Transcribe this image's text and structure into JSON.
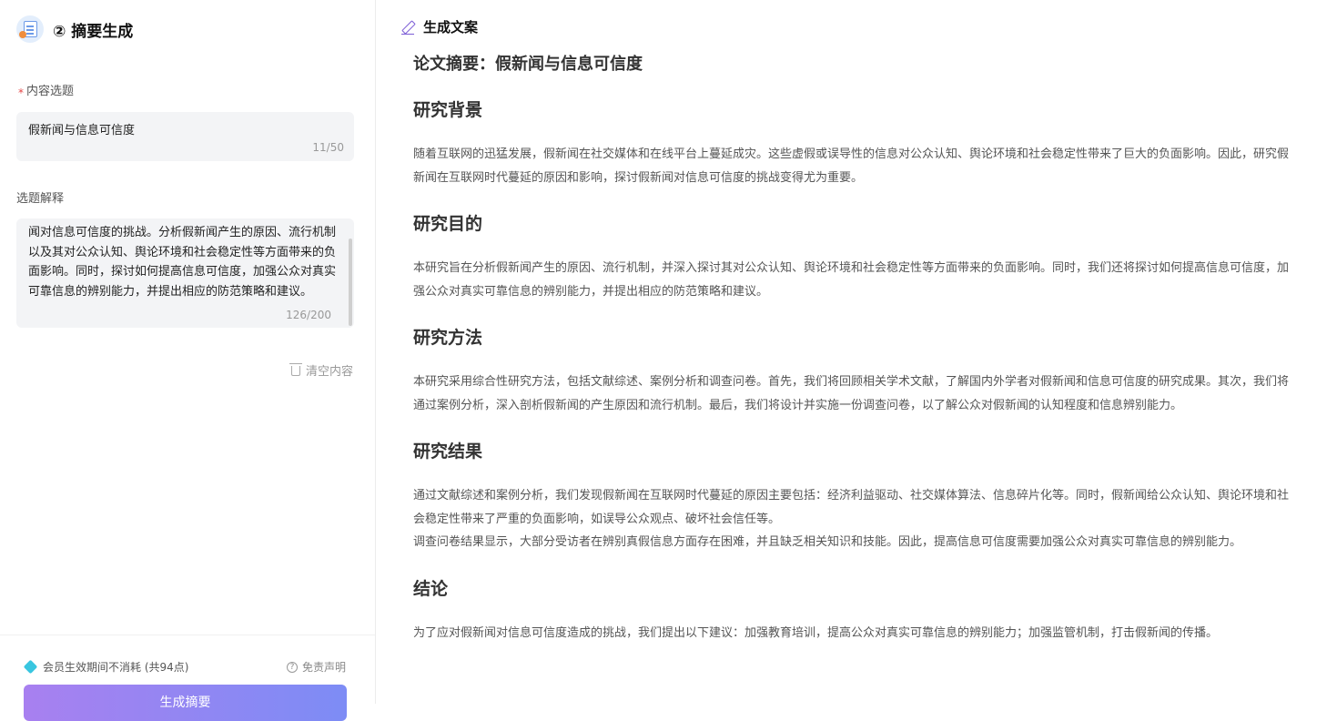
{
  "left": {
    "app_title": "② 摘要生成",
    "topic": {
      "required_mark": "*",
      "label": "内容选题",
      "value": "假新闻与信息可信度",
      "count": "11/50"
    },
    "explanation": {
      "label": "选题解释",
      "value": "闻对信息可信度的挑战。分析假新闻产生的原因、流行机制以及其对公众认知、舆论环境和社会稳定性等方面带来的负面影响。同时，探讨如何提高信息可信度，加强公众对真实可靠信息的辨别能力，并提出相应的防范策略和建议。",
      "count": "126/200"
    },
    "clear_label": "清空内容",
    "member_note": "会员生效期间不消耗 (共94点)",
    "disclaimer_label": "免责声明",
    "generate_label": "生成摘要"
  },
  "right": {
    "header_title": "生成文案",
    "doc_title": "论文摘要：假新闻与信息可信度",
    "sections": [
      {
        "heading": "研究背景",
        "paragraphs": [
          "随着互联网的迅猛发展，假新闻在社交媒体和在线平台上蔓延成灾。这些虚假或误导性的信息对公众认知、舆论环境和社会稳定性带来了巨大的负面影响。因此，研究假新闻在互联网时代蔓延的原因和影响，探讨假新闻对信息可信度的挑战变得尤为重要。"
        ]
      },
      {
        "heading": "研究目的",
        "paragraphs": [
          "本研究旨在分析假新闻产生的原因、流行机制，并深入探讨其对公众认知、舆论环境和社会稳定性等方面带来的负面影响。同时，我们还将探讨如何提高信息可信度，加强公众对真实可靠信息的辨别能力，并提出相应的防范策略和建议。"
        ]
      },
      {
        "heading": "研究方法",
        "paragraphs": [
          "本研究采用综合性研究方法，包括文献综述、案例分析和调查问卷。首先，我们将回顾相关学术文献，了解国内外学者对假新闻和信息可信度的研究成果。其次，我们将通过案例分析，深入剖析假新闻的产生原因和流行机制。最后，我们将设计并实施一份调查问卷，以了解公众对假新闻的认知程度和信息辨别能力。"
        ]
      },
      {
        "heading": "研究结果",
        "paragraphs": [
          "通过文献综述和案例分析，我们发现假新闻在互联网时代蔓延的原因主要包括：经济利益驱动、社交媒体算法、信息碎片化等。同时，假新闻给公众认知、舆论环境和社会稳定性带来了严重的负面影响，如误导公众观点、破坏社会信任等。",
          "调查问卷结果显示，大部分受访者在辨别真假信息方面存在困难，并且缺乏相关知识和技能。因此，提高信息可信度需要加强公众对真实可靠信息的辨别能力。"
        ]
      },
      {
        "heading": "结论",
        "paragraphs": [
          "为了应对假新闻对信息可信度造成的挑战，我们提出以下建议：加强教育培训，提高公众对真实可靠信息的辨别能力；加强监管机制，打击假新闻的传播。"
        ]
      }
    ]
  }
}
